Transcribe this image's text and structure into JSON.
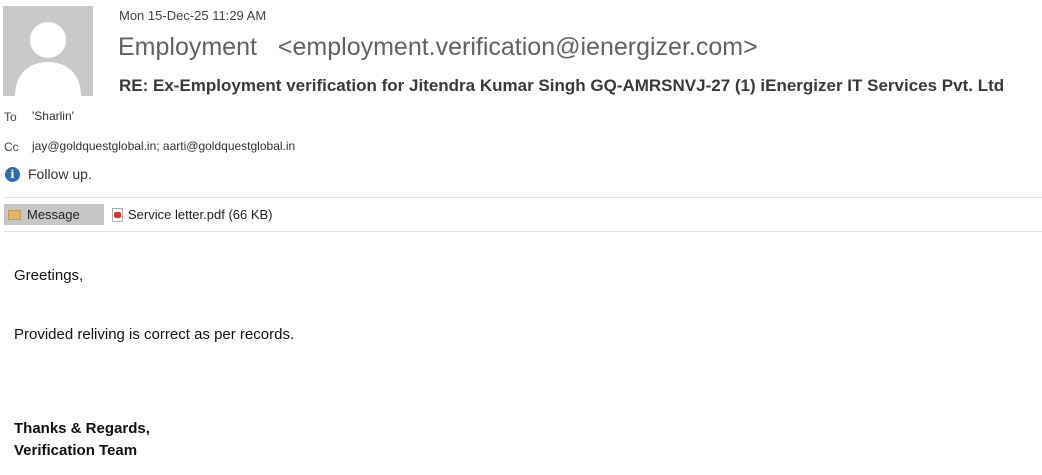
{
  "header": {
    "date": "Mon 15-Dec-25 11:29 AM",
    "sender_name": "Employment",
    "sender_email": "<employment.verification@ienergizer.com>",
    "subject": "RE: Ex-Employment verification for Jitendra Kumar Singh GQ-AMRSNVJ-27 (1)  iEnergizer IT Services Pvt. Ltd",
    "to_label": "To",
    "to_value": "'Sharlin'",
    "cc_label": "Cc",
    "cc_value": "jay@goldquestglobal.in; aarti@goldquestglobal.in",
    "info_text": "Follow up."
  },
  "tabs": {
    "message_label": "Message",
    "attachment_label": "Service letter.pdf (66 KB)"
  },
  "body": {
    "greeting": "Greetings,",
    "line1": "Provided reliving is correct as per records.",
    "sign1": "Thanks & Regards,",
    "sign2": "Verification Team"
  },
  "icons": [
    "avatar-icon",
    "info-icon",
    "envelope-icon",
    "pdf-icon"
  ],
  "colors": {
    "info_blue": "#2e6db4",
    "tab_gray": "#c7c7c7",
    "pdf_red": "#d9342b"
  }
}
